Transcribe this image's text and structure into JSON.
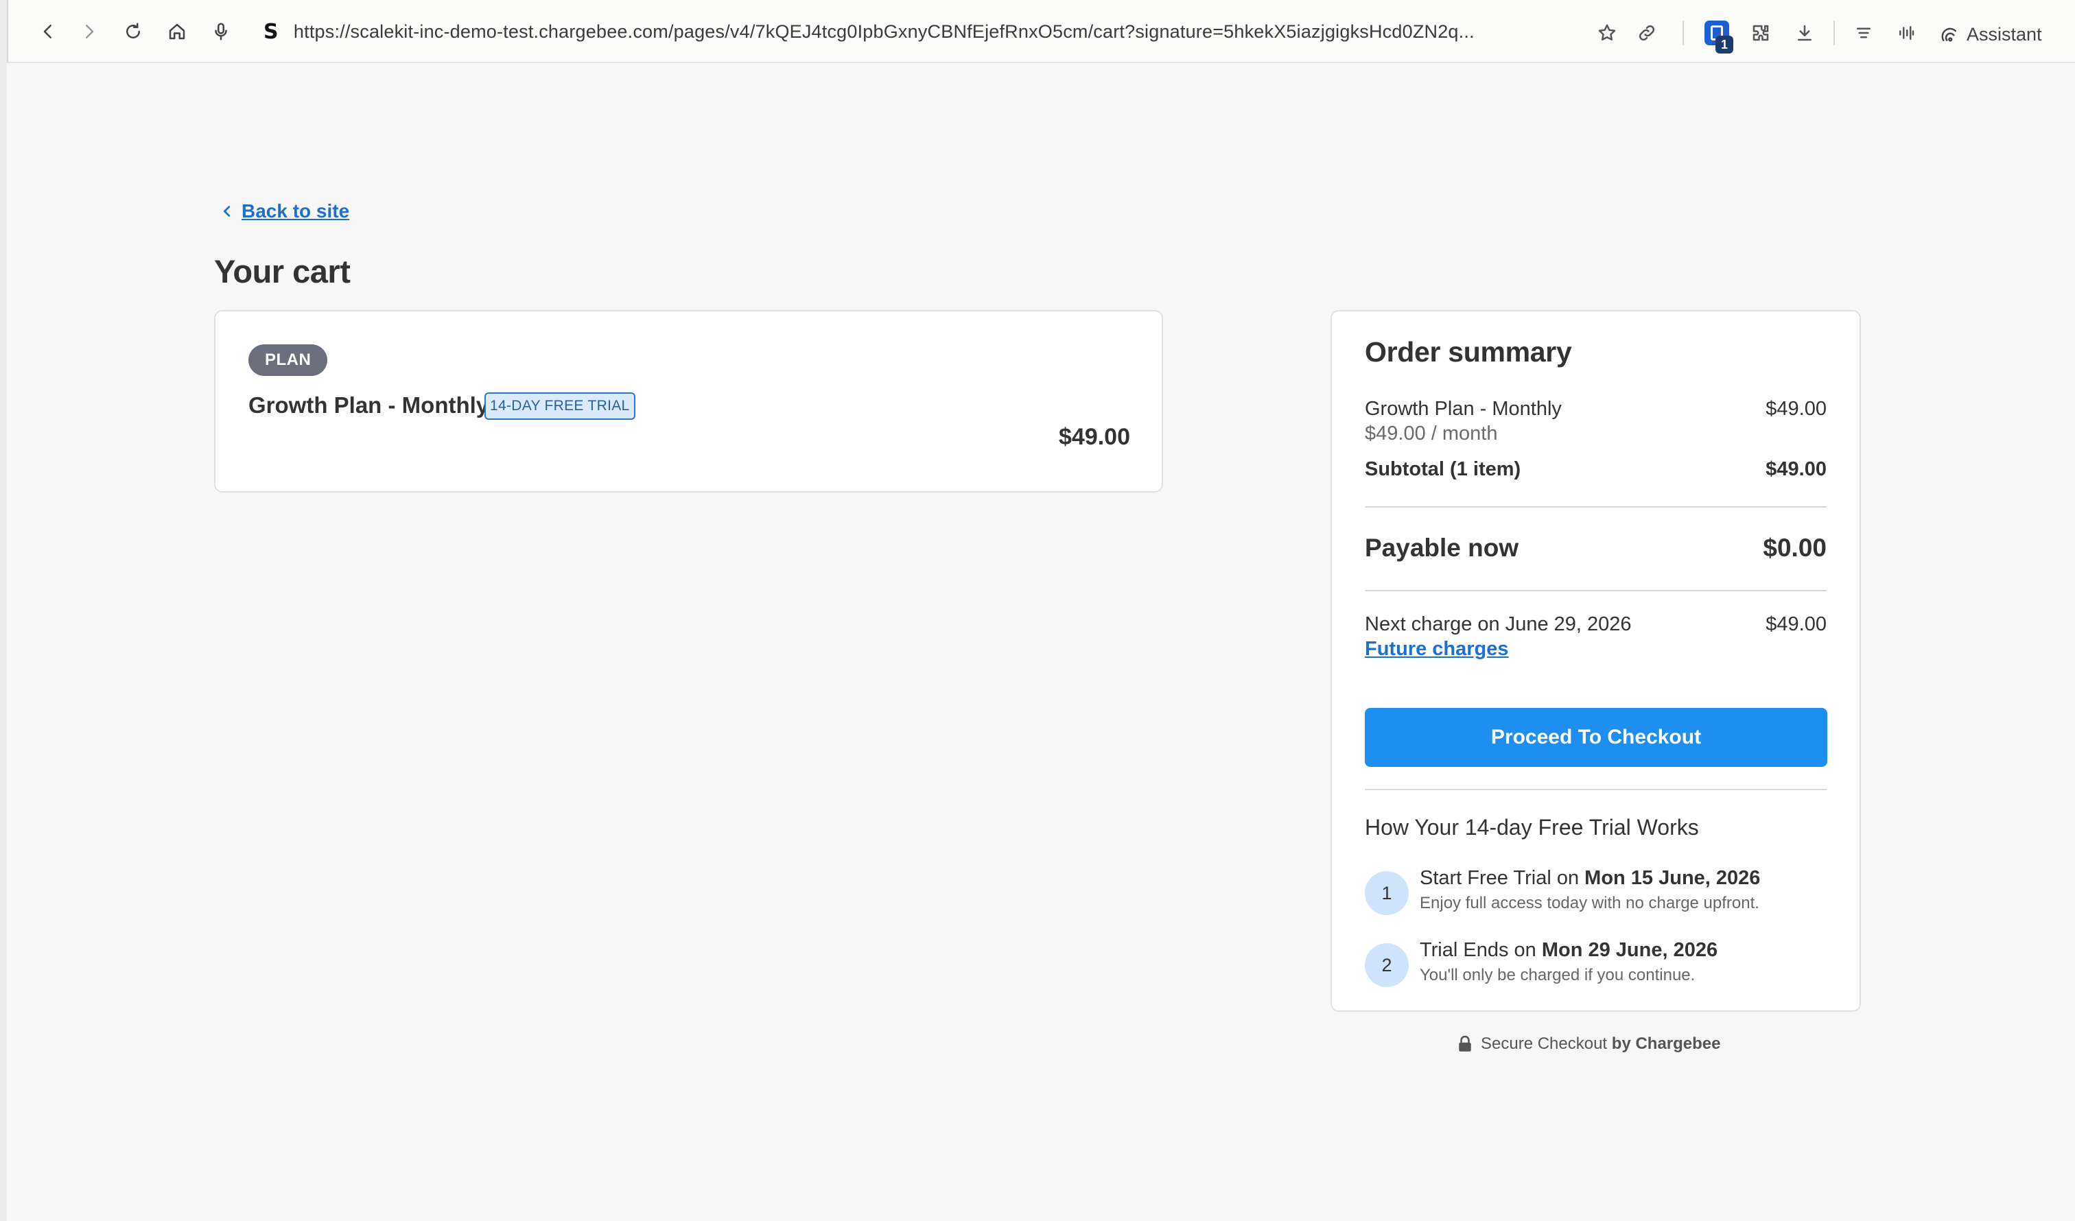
{
  "browser": {
    "url": "https://scalekit-inc-demo-test.chargebee.com/pages/v4/7kQEJ4tcg0IpbGxnyCBNfEjefRnxO5cm/cart?signature=5hkekX5iazjgigksHcd0ZN2q...",
    "site_glyph": "S",
    "extension_badge_count": "1",
    "assistant_label": "Assistant",
    "icons": [
      "back-arrow-icon",
      "forward-arrow-icon",
      "reload-icon",
      "home-icon",
      "microphone-icon",
      "star-icon",
      "link-icon",
      "extension-badge-icon",
      "puzzle-icon",
      "download-icon",
      "reader-icon",
      "audio-wave-icon",
      "assistant-icon"
    ]
  },
  "page": {
    "back_label": "Back to site",
    "title": "Your cart"
  },
  "cart_item": {
    "badge": "PLAN",
    "name": "Growth Plan - Monthly",
    "trial_tag": "14-DAY FREE TRIAL",
    "price": "$49.00"
  },
  "summary": {
    "title": "Order summary",
    "line_item": {
      "name": "Growth Plan - Monthly",
      "price": "$49.00",
      "rate": "$49.00 / month"
    },
    "subtotal": {
      "label": "Subtotal (1 item)",
      "value": "$49.00"
    },
    "payable": {
      "label": "Payable now",
      "value": "$0.00"
    },
    "next_charge": {
      "label": "Next charge on June 29, 2026",
      "value": "$49.00",
      "link": "Future charges"
    },
    "checkout_label": "Proceed To Checkout",
    "trial_title": "How Your 14-day Free Trial Works",
    "steps": [
      {
        "num": "1",
        "prefix": "Start Free Trial on ",
        "date": "Mon 15 June, 2026",
        "desc": "Enjoy full access today with no charge upfront."
      },
      {
        "num": "2",
        "prefix": "Trial Ends on ",
        "date": "Mon 29 June, 2026",
        "desc": "You'll only be charged if you continue."
      }
    ]
  },
  "footer": {
    "secure_prefix": "Secure Checkout ",
    "secure_brand": "by Chargebee"
  },
  "colors": {
    "accent": "#1e8ff0",
    "link": "#1d6fd0",
    "pill": "#6b6f7b",
    "trial_tag_bg": "#dbeafb"
  }
}
